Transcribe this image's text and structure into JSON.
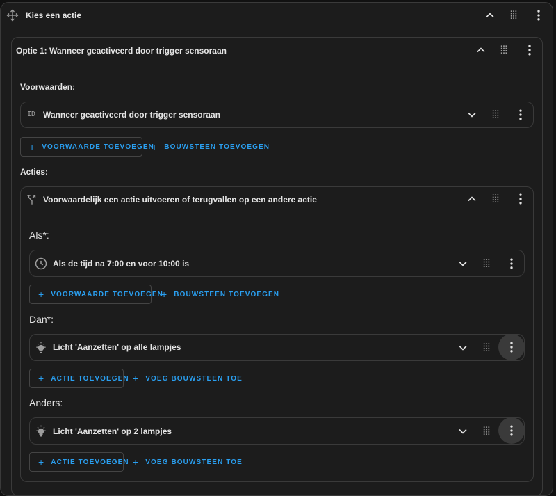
{
  "outer": {
    "title": "Kies een actie",
    "icons": [
      "move-icon",
      "chevron-up-icon",
      "drag-grid-icon",
      "more-vert-icon"
    ]
  },
  "option": {
    "title": "Optie 1: Wanneer geactiveerd door trigger sensoraan"
  },
  "conditions": {
    "label": "Voorwaarden:",
    "item": {
      "icon_text": "ID",
      "title": "Wanneer geactiveerd door trigger sensoraan"
    },
    "add_condition": "VOORWAARDE TOEVOEGEN",
    "add_block": "BOUWSTEEN TOEVOEGEN"
  },
  "actions": {
    "label": "Acties:",
    "choose": {
      "title": "Voorwaardelijk een actie uitvoeren of terugvallen op een andere actie",
      "if_label": "Als*:",
      "if_item": "Als de tijd na 7:00 en voor 10:00 is",
      "if_add_condition": "VOORWAARDE TOEVOEGEN",
      "if_add_block": "BOUWSTEEN TOEVOEGEN",
      "then_label": "Dan*:",
      "then_item": "Licht 'Aanzetten' op alle lampjes",
      "then_add_action": "ACTIE TOEVOEGEN",
      "then_add_block": "VOEG BOUWSTEEN TOE",
      "else_label": "Anders:",
      "else_item": "Licht 'Aanzetten' op 2 lampjes",
      "else_add_action": "ACTIE TOEVOEGEN",
      "else_add_block": "VOEG BOUWSTEEN TOE"
    }
  },
  "colors": {
    "accent": "#2a9ff0",
    "background": "#1c1c1c",
    "border": "#3a3a3a",
    "text": "#e1e1e1"
  }
}
